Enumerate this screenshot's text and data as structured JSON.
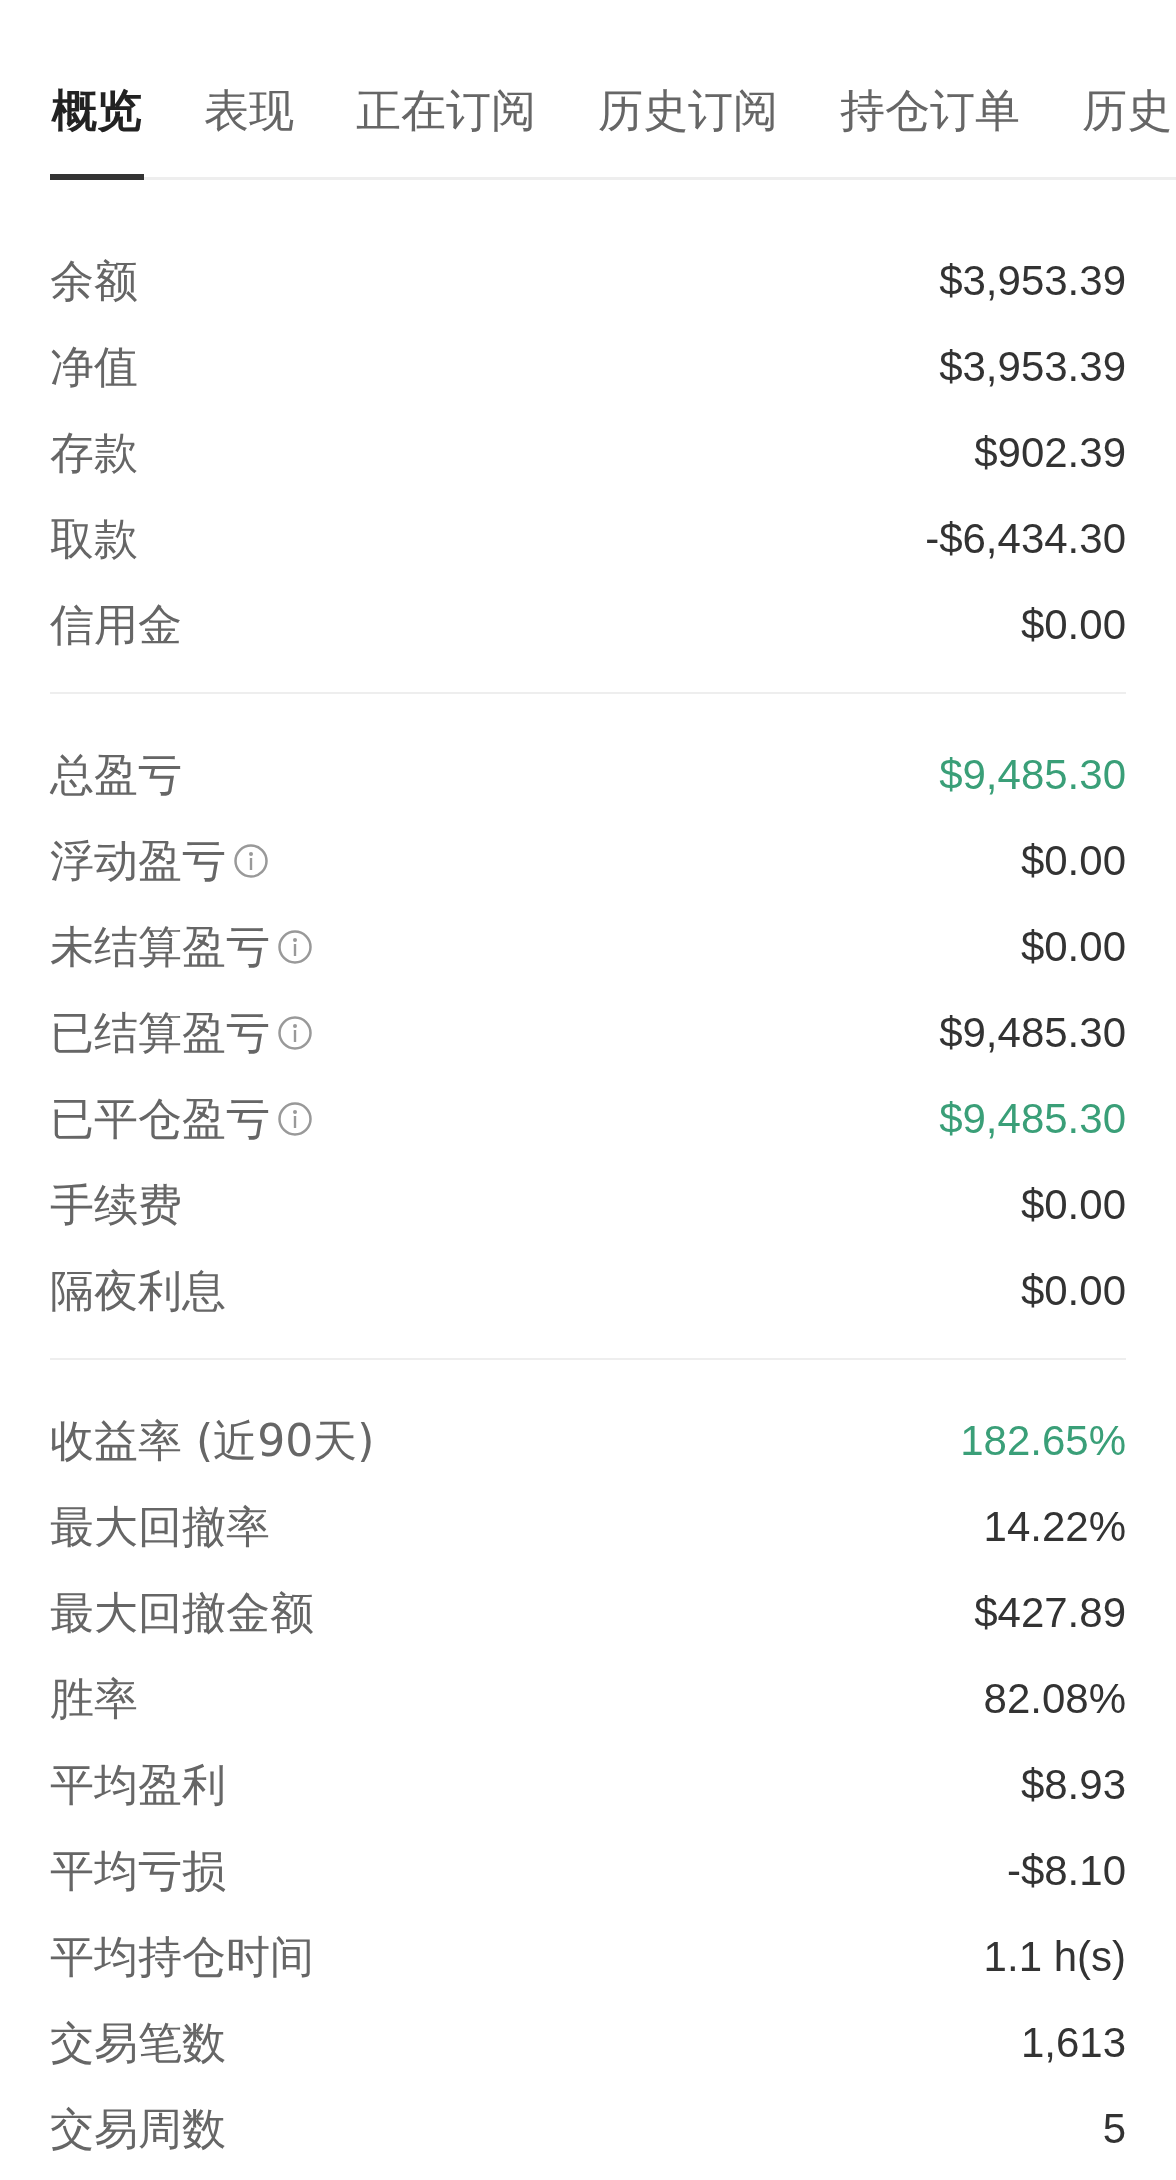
{
  "tabs": [
    {
      "label": "概览",
      "selected": true
    },
    {
      "label": "表现",
      "selected": false
    },
    {
      "label": "正在订阅",
      "selected": false
    },
    {
      "label": "历史订阅",
      "selected": false
    },
    {
      "label": "持仓订单",
      "selected": false
    },
    {
      "label": "历史",
      "selected": false
    }
  ],
  "sections": [
    {
      "rows": [
        {
          "label": "余额",
          "value": "$3,953.39",
          "info": false,
          "color": "#333333"
        },
        {
          "label": "净值",
          "value": "$3,953.39",
          "info": false,
          "color": "#333333"
        },
        {
          "label": "存款",
          "value": "$902.39",
          "info": false,
          "color": "#333333"
        },
        {
          "label": "取款",
          "value": "-$6,434.30",
          "info": false,
          "color": "#333333"
        },
        {
          "label": "信用金",
          "value": "$0.00",
          "info": false,
          "color": "#333333"
        }
      ]
    },
    {
      "rows": [
        {
          "label": "总盈亏",
          "value": "$9,485.30",
          "info": false,
          "color": "#3a9f78"
        },
        {
          "label": "浮动盈亏",
          "value": "$0.00",
          "info": true,
          "color": "#333333"
        },
        {
          "label": "未结算盈亏",
          "value": "$0.00",
          "info": true,
          "color": "#333333"
        },
        {
          "label": "已结算盈亏",
          "value": "$9,485.30",
          "info": true,
          "color": "#333333"
        },
        {
          "label": "已平仓盈亏",
          "value": "$9,485.30",
          "info": true,
          "color": "#3a9f78"
        },
        {
          "label": "手续费",
          "value": "$0.00",
          "info": false,
          "color": "#333333"
        },
        {
          "label": "隔夜利息",
          "value": "$0.00",
          "info": false,
          "color": "#333333"
        }
      ]
    },
    {
      "rows": [
        {
          "label": "收益率 (近90天)",
          "value": "182.65%",
          "info": false,
          "color": "#3a9f78"
        },
        {
          "label": "最大回撤率",
          "value": "14.22%",
          "info": false,
          "color": "#333333"
        },
        {
          "label": "最大回撤金额",
          "value": "$427.89",
          "info": false,
          "color": "#333333"
        },
        {
          "label": "胜率",
          "value": "82.08%",
          "info": false,
          "color": "#333333"
        },
        {
          "label": "平均盈利",
          "value": "$8.93",
          "info": false,
          "color": "#333333"
        },
        {
          "label": "平均亏损",
          "value": "-$8.10",
          "info": false,
          "color": "#333333"
        },
        {
          "label": "平均持仓时间",
          "value": "1.1 h(s)",
          "info": false,
          "color": "#333333"
        },
        {
          "label": "交易笔数",
          "value": "1,613",
          "info": false,
          "color": "#333333"
        },
        {
          "label": "交易周数",
          "value": "5",
          "info": false,
          "color": "#333333"
        }
      ]
    }
  ]
}
